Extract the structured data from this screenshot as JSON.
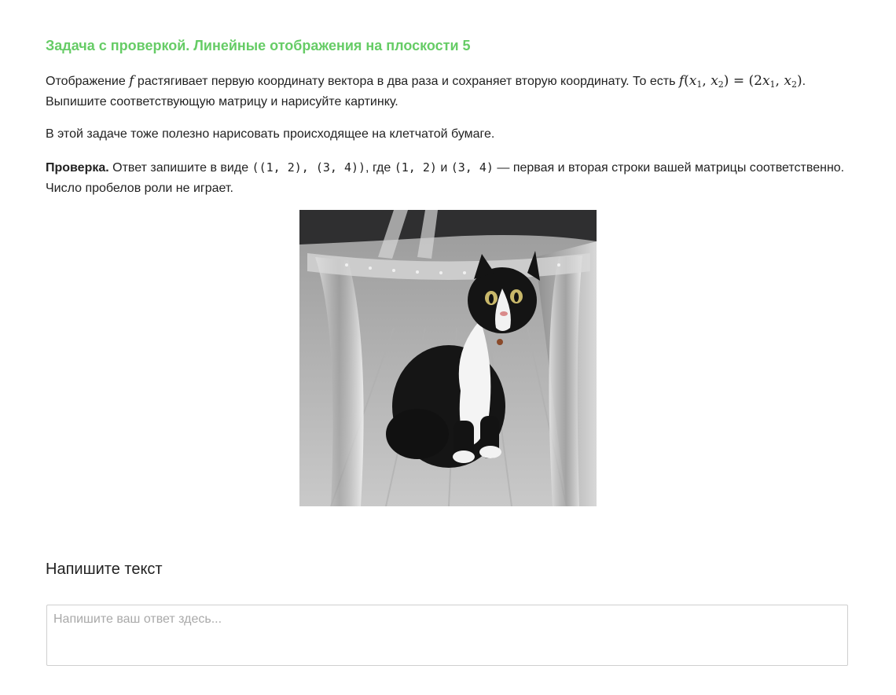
{
  "task": {
    "title": "Задача с проверкой. Линейные отображения на плоскости 5",
    "p1": {
      "before": "Отображение ",
      "var": "f",
      "middle": " растягивает первую координату вектора в два раза и сохраняет вторую координату. То есть ",
      "formula": {
        "f": "f",
        "open": "(",
        "x": "x",
        "one": "1",
        "comma": ", ",
        "two": "2",
        "close": ")",
        "eq": " = (",
        "coef": "2"
      },
      "end": ".",
      "second_line": " Выпишите соответствующую матрицу и нарисуйте картинку."
    },
    "p2": "В этой задаче тоже полезно нарисовать происходящее на клетчатой бумаге.",
    "p3": {
      "bold": "Проверка.",
      "t1": " Ответ запишите в виде ",
      "code1": "((1, 2), (3, 4))",
      "t2": ", где ",
      "code2": "(1, 2)",
      "t3": " и ",
      "code3": "(3, 4)",
      "t4": " — первая и вторая строки вашей матрицы соответственно. Число пробелов роли не играет."
    }
  },
  "answer": {
    "heading": "Напишите текст",
    "placeholder": "Напишите ваш ответ здесь...",
    "value": ""
  }
}
